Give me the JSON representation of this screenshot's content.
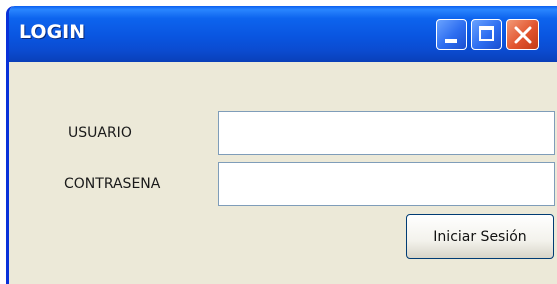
{
  "window": {
    "title": "LOGIN",
    "controls": {
      "minimize_icon": "minimize-icon",
      "maximize_icon": "maximize-icon",
      "close_icon": "close-icon"
    }
  },
  "form": {
    "username_label": "USUARIO",
    "username_value": "",
    "password_label": "CONTRASENA",
    "password_value": "",
    "submit_label": "Iniciar Sesión"
  },
  "colors": {
    "title_bar": "#0a55e0",
    "window_body": "#ece9d8",
    "close_button": "#e2552f",
    "field_border": "#7f9db9"
  }
}
